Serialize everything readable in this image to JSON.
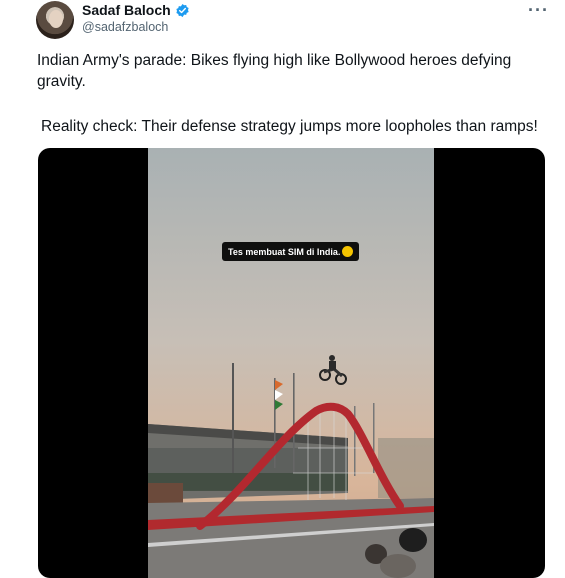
{
  "tweet": {
    "display_name": "Sadaf Baloch",
    "handle": "@sadafzbaloch",
    "more": "···",
    "text_line1": "Indian Army's parade: Bikes flying high like Bollywood heroes defying gravity.",
    "text_line2": "Reality check: Their defense strategy jumps more loopholes than ramps!"
  },
  "video": {
    "caption": "Tes membuat SIM di India."
  },
  "colors": {
    "verified": "#1d9bf0",
    "ramp": "#b3282f",
    "sky_top": "#a9b1b3",
    "sky_bottom": "#d8b59a"
  }
}
